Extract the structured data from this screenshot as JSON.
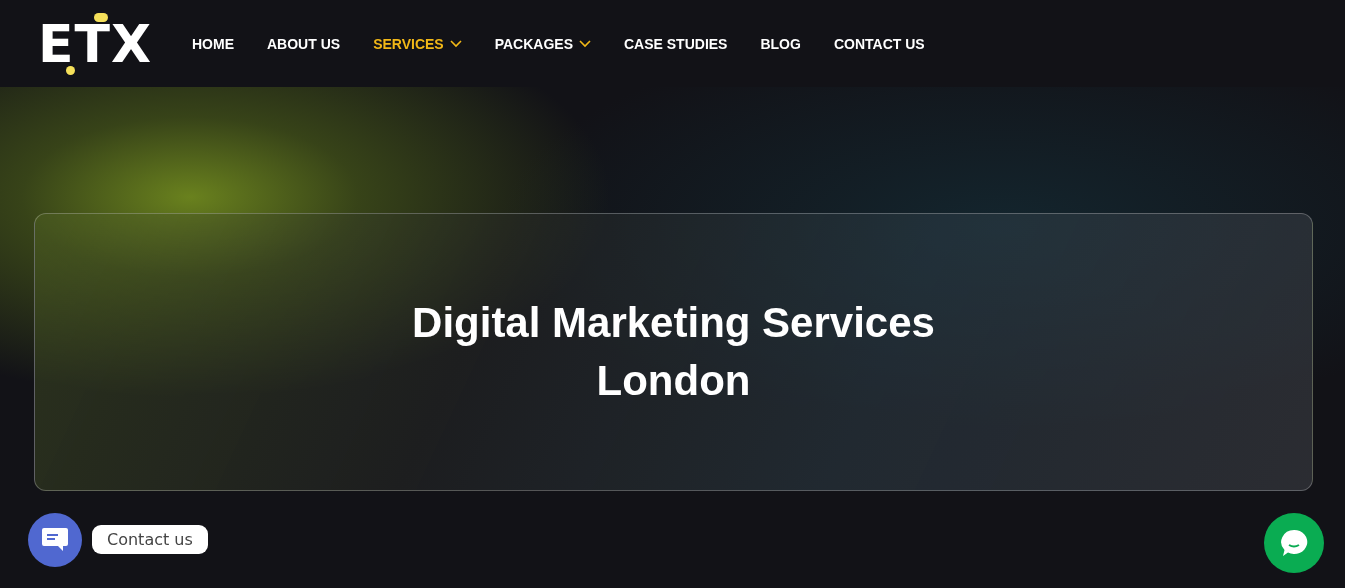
{
  "logo": {
    "text": "ETX"
  },
  "nav": [
    {
      "label": "HOME",
      "selected": false,
      "dropdown": false
    },
    {
      "label": "ABOUT US",
      "selected": false,
      "dropdown": false
    },
    {
      "label": "SERVICES",
      "selected": true,
      "dropdown": true
    },
    {
      "label": "PACKAGES",
      "selected": false,
      "dropdown": true
    },
    {
      "label": "CASE STUDIES",
      "selected": false,
      "dropdown": false
    },
    {
      "label": "BLOG",
      "selected": false,
      "dropdown": false
    },
    {
      "label": "CONTACT US",
      "selected": false,
      "dropdown": false
    }
  ],
  "hero": {
    "title": "Digital Marketing Services London"
  },
  "contact_widget": {
    "label": "Contact us"
  }
}
